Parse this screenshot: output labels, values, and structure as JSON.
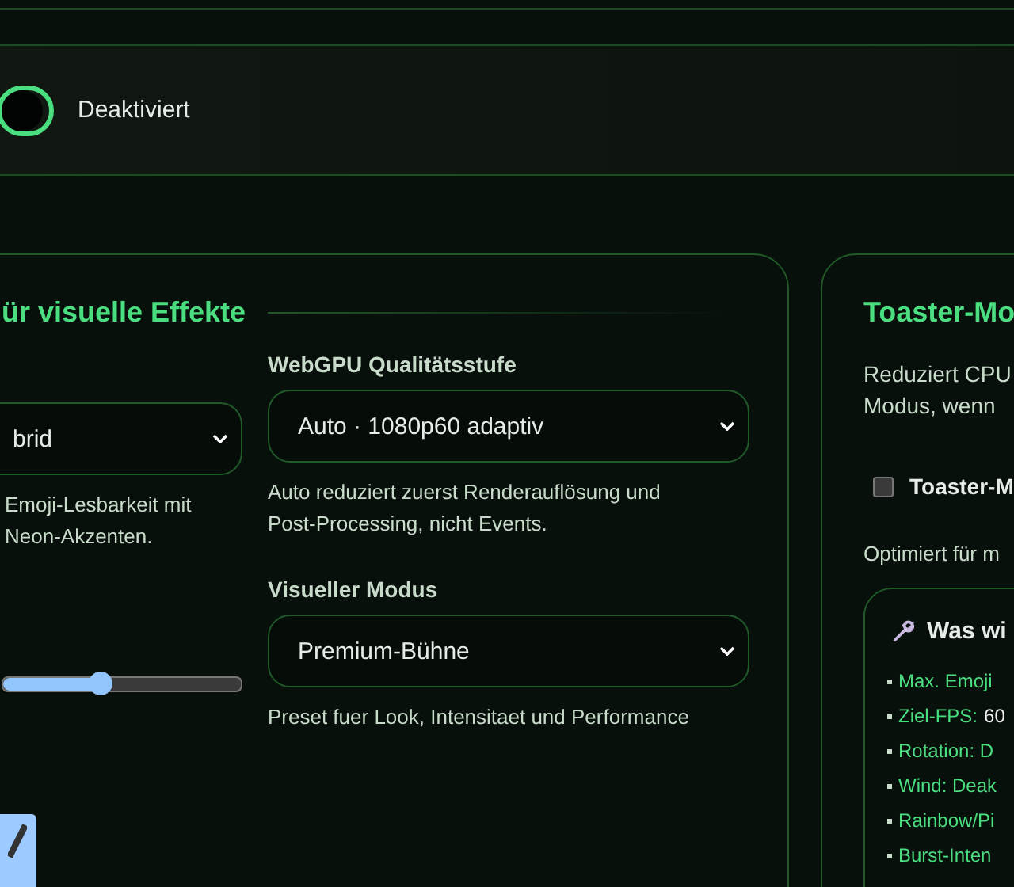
{
  "top_toggle": {
    "on": false,
    "label": "Deaktiviert"
  },
  "effects_panel": {
    "title": "ür visuelle Effekte",
    "render_select": {
      "value": "brid"
    },
    "render_hint": [
      "Emoji-Lesbarkeit mit",
      "Neon-Akzenten."
    ],
    "quality": {
      "label": "WebGPU Qualitätsstufe",
      "value": "Auto · 1080p60 adaptiv",
      "hint": [
        "Auto reduziert zuerst Renderauflösung und",
        "Post-Processing, nicht Events."
      ]
    },
    "mode": {
      "label": "Visueller Modus",
      "value": "Premium-Bühne",
      "hint": [
        "Preset fuer Look, Intensitaet und Performance"
      ]
    }
  },
  "toaster_panel": {
    "title": "Toaster-Mo",
    "description": [
      "Reduziert CPU",
      "Modus, wenn"
    ],
    "checkbox": {
      "label": "Toaster-M",
      "checked": false
    },
    "note": "Optimiert für m",
    "changes": {
      "title": "Was wi",
      "items": [
        {
          "label": "Max. Emoji"
        },
        {
          "label": "Ziel-FPS:",
          "value": "60"
        },
        {
          "label": "Rotation: D"
        },
        {
          "label": "Wind: Deak"
        },
        {
          "label": "Rainbow/Pi"
        },
        {
          "label": "Burst-Inten"
        }
      ]
    }
  }
}
